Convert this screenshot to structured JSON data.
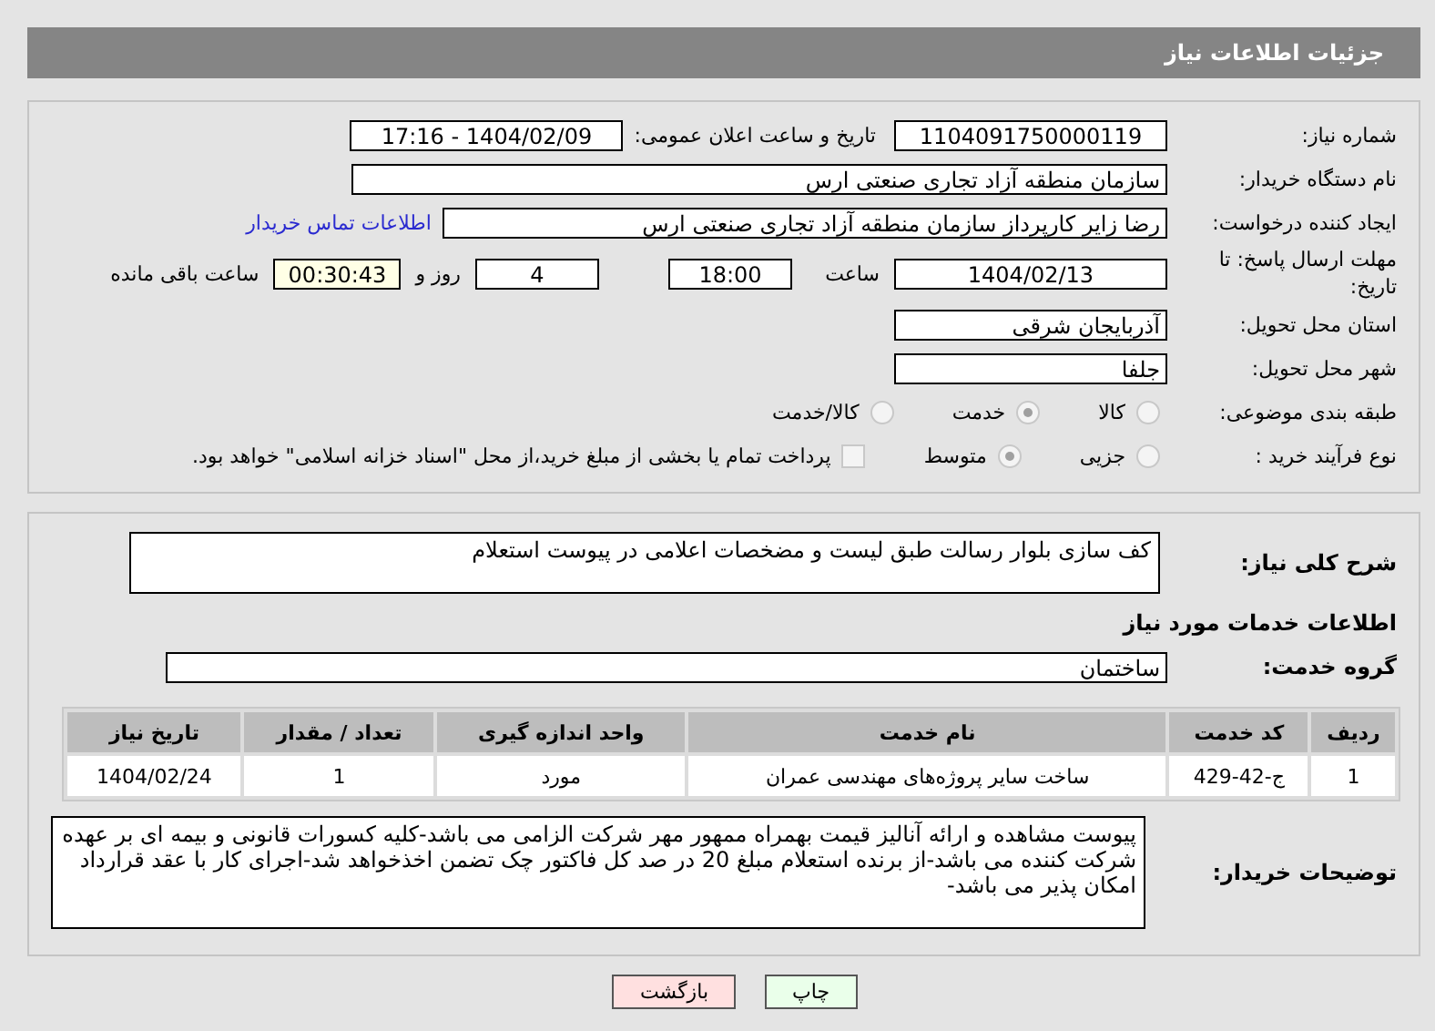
{
  "header": {
    "title": "جزئیات اطلاعات نیاز"
  },
  "need_number": {
    "label": "شماره نیاز:",
    "value": "1104091750000119"
  },
  "announce": {
    "label": "تاریخ و ساعت اعلان عمومی:",
    "value": "1404/02/09 - 17:16"
  },
  "buyer": {
    "label": "نام دستگاه خریدار:",
    "value": "سازمان منطقه آزاد تجاری صنعتی ارس"
  },
  "creator": {
    "label": "ایجاد کننده درخواست:",
    "value": "رضا زایر کارپرداز سازمان منطقه آزاد تجاری صنعتی ارس",
    "link": "اطلاعات تماس خریدار"
  },
  "deadline": {
    "label": "مهلت ارسال پاسخ: تا تاریخ:",
    "date": "1404/02/13",
    "time_label": "ساعت",
    "time": "18:00",
    "days": "4",
    "days_label": "روز و",
    "remaining": "00:30:43",
    "remaining_label": "ساعت باقی مانده"
  },
  "province": {
    "label": "استان محل تحویل:",
    "value": "آذربایجان شرقی"
  },
  "city": {
    "label": "شهر محل تحویل:",
    "value": "جلفا"
  },
  "category": {
    "label": "طبقه بندی موضوعی:",
    "options": [
      {
        "label": "کالا",
        "selected": false
      },
      {
        "label": "خدمت",
        "selected": true
      },
      {
        "label": "کالا/خدمت",
        "selected": false
      }
    ]
  },
  "process": {
    "label": "نوع فرآیند خرید :",
    "options": [
      {
        "label": "جزیی",
        "selected": false
      },
      {
        "label": "متوسط",
        "selected": true
      }
    ],
    "payment": {
      "checked": false,
      "text": "پرداخت تمام یا بخشی از مبلغ خرید،از محل \"اسناد خزانه اسلامی\" خواهد بود."
    }
  },
  "description": {
    "label": "شرح کلی نیاز:",
    "value": "کف سازی بلوار رسالت طبق لیست و مضخصات اعلامی در پیوست استعلام"
  },
  "services_heading": "اطلاعات خدمات مورد نیاز",
  "service_group": {
    "label": "گروه خدمت:",
    "value": "ساختمان"
  },
  "table": {
    "columns": [
      "ردیف",
      "کد خدمت",
      "نام خدمت",
      "واحد اندازه گیری",
      "تعداد / مقدار",
      "تاریخ نیاز"
    ],
    "rows": [
      [
        "1",
        "ج-42-429",
        "ساخت سایر پروژه‌های مهندسی عمران",
        "مورد",
        "1",
        "1404/02/24"
      ]
    ]
  },
  "buyer_notes": {
    "label": "توضیحات خریدار:",
    "value": "پیوست مشاهده و ارائه آنالیز قیمت بهمراه ممهور مهر شرکت الزامی می باشد-کلیه کسورات قانونی و بیمه ای بر عهده شرکت کننده می باشد-از برنده استعلام مبلغ 20 در صد کل فاکتور چک تضمن اخذخواهد شد-اجرای کار با عقد قرارداد امکان پذیر می باشد-"
  },
  "buttons": [
    {
      "label": "چاپ",
      "kind": "print"
    },
    {
      "label": "بازگشت",
      "kind": "back"
    }
  ]
}
